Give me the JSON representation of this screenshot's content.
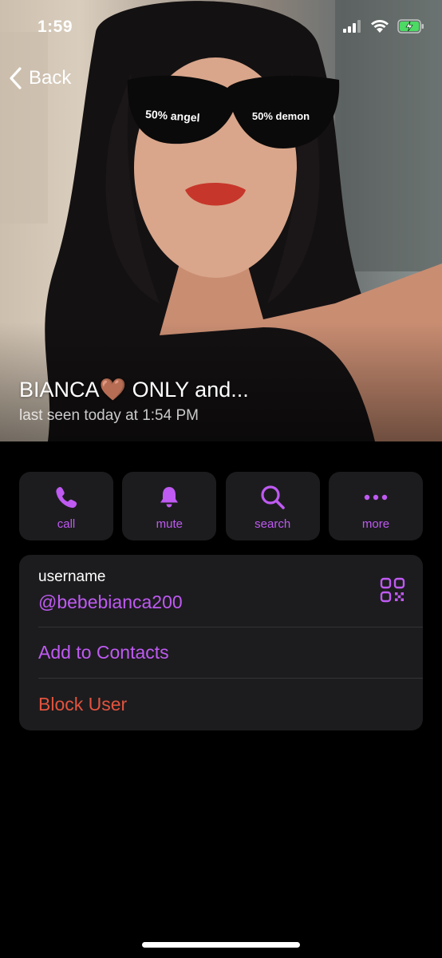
{
  "status_bar": {
    "time": "1:59",
    "icons": [
      "cellular-signal-icon",
      "wifi-icon",
      "battery-charging-icon"
    ]
  },
  "nav": {
    "back_label": "Back",
    "back_icon": "chevron-left-icon"
  },
  "profile": {
    "name": "BIANCA🤎 ONLY and...",
    "last_seen": "last seen today at 1:54 PM",
    "photo_sticker_left": "50% angel",
    "photo_sticker_right": "50% demon"
  },
  "actions": [
    {
      "label": "call",
      "icon": "phone-icon"
    },
    {
      "label": "mute",
      "icon": "bell-icon"
    },
    {
      "label": "search",
      "icon": "search-icon"
    },
    {
      "label": "more",
      "icon": "more-dots-icon"
    }
  ],
  "info": {
    "username_caption": "username",
    "username_value": "@bebebianca200",
    "qr_icon": "qr-code-icon",
    "add_contact_label": "Add to Contacts",
    "block_label": "Block User"
  },
  "colors": {
    "accent": "#bf5af2",
    "destructive": "#e2533e",
    "card_background": "#1c1c1e",
    "page_background": "#000000"
  }
}
